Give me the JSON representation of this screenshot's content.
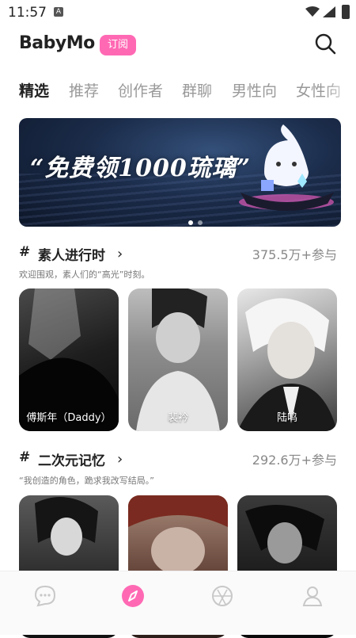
{
  "status_bar": {
    "time": "11:57",
    "notif_icon": "a-icon"
  },
  "header": {
    "logo": "BabyMo",
    "subscribe_label": "订阅",
    "search_icon": "search-icon"
  },
  "tabs": [
    {
      "label": "精选",
      "active": true
    },
    {
      "label": "推荐",
      "active": false
    },
    {
      "label": "创作者",
      "active": false
    },
    {
      "label": "群聊",
      "active": false
    },
    {
      "label": "男性向",
      "active": false
    },
    {
      "label": "女性向",
      "active": false
    }
  ],
  "banner": {
    "headline": "“免费领1000琉璃”",
    "slides": 2,
    "active_slide": 0
  },
  "sections": [
    {
      "hash": "#",
      "title": "素人进行时",
      "count": "375.5万+参与",
      "desc": "欢迎围观，素人们的“高光”时刻。",
      "cards": [
        {
          "name": "傅斯年（Daddy）"
        },
        {
          "name": "裴衿"
        },
        {
          "name": "陆鸣"
        }
      ]
    },
    {
      "hash": "#",
      "title": "二次元记忆",
      "count": "292.6万+参与",
      "desc": "“我创造的角色，跪求我改写结局。”",
      "cards": [
        {
          "name": ""
        },
        {
          "name": ""
        },
        {
          "name": ""
        }
      ]
    }
  ],
  "bottom_nav": [
    {
      "icon": "chat-bubble-icon",
      "active": false
    },
    {
      "icon": "discover-compass-icon",
      "active": true
    },
    {
      "icon": "aperture-icon",
      "active": false
    },
    {
      "icon": "profile-icon",
      "active": false
    }
  ],
  "colors": {
    "accent": "#ff69b4",
    "text": "#222222",
    "muted": "#999999"
  }
}
